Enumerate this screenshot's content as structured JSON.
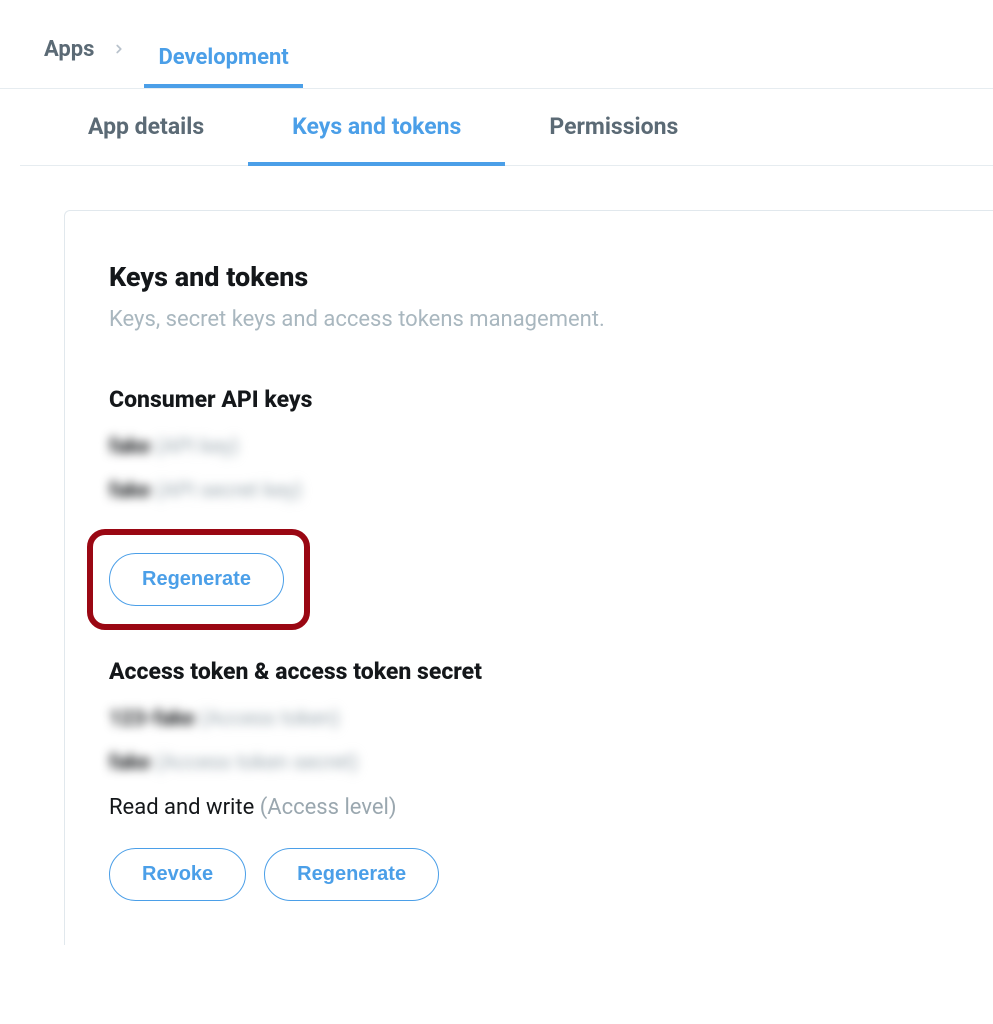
{
  "breadcrumb": {
    "root": "Apps",
    "current": "Development"
  },
  "tabs": {
    "details": "App details",
    "keys": "Keys and tokens",
    "permissions": "Permissions"
  },
  "card": {
    "title": "Keys and tokens",
    "description": "Keys, secret keys and access tokens management."
  },
  "consumer": {
    "title": "Consumer API keys",
    "api_key_value": "fake",
    "api_key_label": "(API key)",
    "api_secret_value": "fake",
    "api_secret_label": "(API secret key)",
    "regenerate": "Regenerate"
  },
  "access": {
    "title": "Access token & access token secret",
    "token_value": "123-fake",
    "token_label": "(Access token)",
    "secret_value": "fake",
    "secret_label": "(Access token secret)",
    "level_value": "Read and write",
    "level_label": "(Access level)",
    "revoke": "Revoke",
    "regenerate": "Regenerate"
  }
}
